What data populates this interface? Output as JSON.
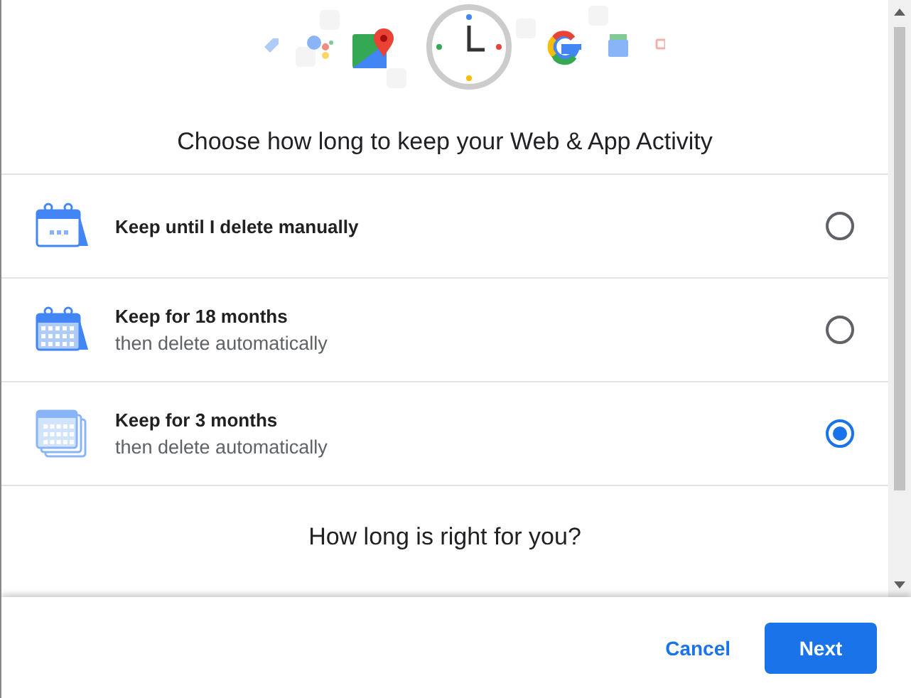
{
  "title": "Choose how long to keep your Web & App Activity",
  "options": [
    {
      "kind": "dots",
      "label": "Keep until I delete manually",
      "selected": false
    },
    {
      "kind": "grid",
      "label": "Keep for 18 months",
      "sublabel": "then delete automatically",
      "selected": false
    },
    {
      "kind": "stack",
      "label": "Keep for 3 months",
      "sublabel": "then delete automatically",
      "selected": true
    }
  ],
  "question": "How long is right for you?",
  "buttons": {
    "cancel": "Cancel",
    "next": "Next"
  }
}
